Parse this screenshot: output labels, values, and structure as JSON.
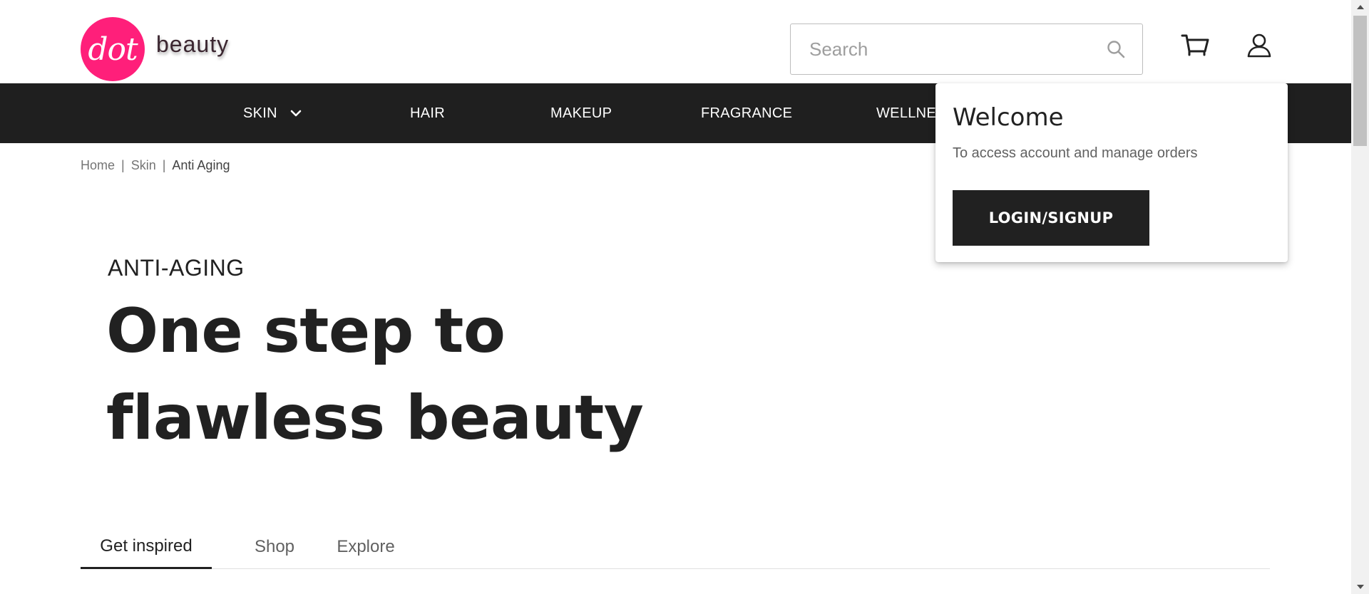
{
  "brand": {
    "logo_text": "dot",
    "name": "beauty",
    "logo_color": "#ff1f7a"
  },
  "search": {
    "placeholder": "Search",
    "icon": "search-icon"
  },
  "header_icons": {
    "cart": "cart-icon",
    "account": "user-icon"
  },
  "nav": {
    "items": [
      {
        "label": "SKIN",
        "has_dropdown": true
      },
      {
        "label": "HAIR"
      },
      {
        "label": "MAKEUP"
      },
      {
        "label": "FRAGRANCE"
      },
      {
        "label": "WELLNE"
      }
    ],
    "background": "#1f1f1f"
  },
  "breadcrumb": {
    "items": [
      "Home",
      "Skin",
      "Anti Aging"
    ],
    "separator": "|"
  },
  "hero": {
    "eyebrow": "ANTI-AGING",
    "headline": "One step to flawless beauty"
  },
  "tabs": {
    "items": [
      "Get inspired",
      "Shop",
      "Explore"
    ],
    "active": "Get inspired"
  },
  "account_popover": {
    "title": "Welcome",
    "subtitle": "To access account and manage orders",
    "button_label": "LOGIN/SIGNUP"
  }
}
